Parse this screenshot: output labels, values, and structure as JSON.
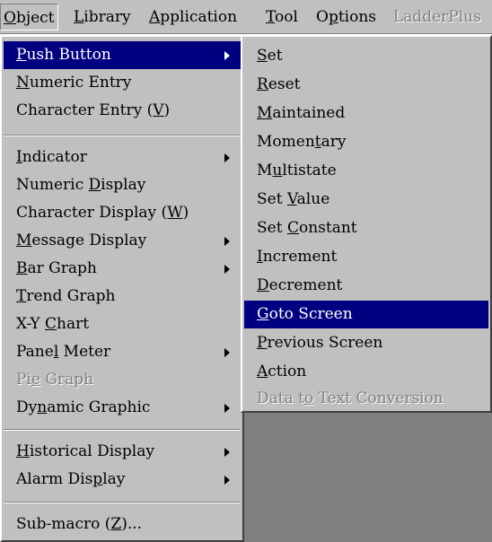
{
  "menubar": {
    "items": [
      {
        "pre": "",
        "key": "O",
        "post": "bject"
      },
      {
        "pre": "",
        "key": "L",
        "post": "ibrary"
      },
      {
        "pre": "",
        "key": "A",
        "post": "pplication"
      },
      {
        "pre": "",
        "key": "T",
        "post": "ool"
      },
      {
        "pre": "O",
        "key": "p",
        "post": "tions"
      },
      {
        "pre": "LadderPlus",
        "key": "",
        "post": ""
      }
    ]
  },
  "object_menu": {
    "items": [
      {
        "pre": "",
        "key": "P",
        "post": "ush Button"
      },
      {
        "pre": "",
        "key": "N",
        "post": "umeric Entry"
      },
      {
        "pre": "Character Entry (",
        "key": "V",
        "post": ")"
      },
      {
        "pre": "",
        "key": "I",
        "post": "ndicator"
      },
      {
        "pre": "Numeric ",
        "key": "D",
        "post": "isplay"
      },
      {
        "pre": "Character Display (",
        "key": "W",
        "post": ")"
      },
      {
        "pre": "",
        "key": "M",
        "post": "essage Display"
      },
      {
        "pre": "",
        "key": "B",
        "post": "ar Graph"
      },
      {
        "pre": "",
        "key": "T",
        "post": "rend Graph"
      },
      {
        "pre": "X-Y ",
        "key": "C",
        "post": "hart"
      },
      {
        "pre": "Pane",
        "key": "l",
        "post": " Meter"
      },
      {
        "pre": "Pi",
        "key": "e",
        "post": " Graph"
      },
      {
        "pre": "Dy",
        "key": "n",
        "post": "amic Graphic"
      },
      {
        "pre": "",
        "key": "H",
        "post": "istorical Display"
      },
      {
        "pre": "Alarm Dis",
        "key": "p",
        "post": "lay"
      },
      {
        "pre": "Sub-macro (",
        "key": "Z",
        "post": ")..."
      }
    ]
  },
  "push_button_menu": {
    "items": [
      {
        "pre": "",
        "key": "S",
        "post": "et"
      },
      {
        "pre": "",
        "key": "R",
        "post": "eset"
      },
      {
        "pre": "",
        "key": "M",
        "post": "aintained"
      },
      {
        "pre": "Momen",
        "key": "t",
        "post": "ary"
      },
      {
        "pre": "M",
        "key": "u",
        "post": "ltistate"
      },
      {
        "pre": "Set ",
        "key": "V",
        "post": "alue"
      },
      {
        "pre": "Set ",
        "key": "C",
        "post": "onstant"
      },
      {
        "pre": "",
        "key": "I",
        "post": "ncrement"
      },
      {
        "pre": "",
        "key": "D",
        "post": "ecrement"
      },
      {
        "pre": "",
        "key": "G",
        "post": "oto Screen"
      },
      {
        "pre": "",
        "key": "P",
        "post": "revious Screen"
      },
      {
        "pre": "",
        "key": "A",
        "post": "ction"
      },
      {
        "pre": "Data t",
        "key": "o",
        "post": " Text Conversion"
      }
    ]
  },
  "colors": {
    "menu_face": "#c0c0c0",
    "highlight": "#000080",
    "highlight_text": "#ffffff",
    "disabled_text": "#808080",
    "workspace": "#808080"
  }
}
